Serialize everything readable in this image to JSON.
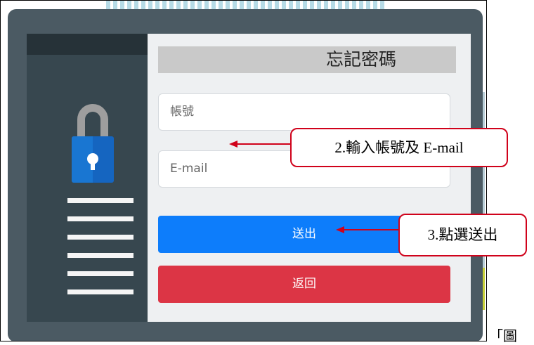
{
  "form": {
    "title": "忘記密碼",
    "account_placeholder": "帳號",
    "email_placeholder": "E-mail",
    "submit_label": "送出",
    "back_label": "返回"
  },
  "callouts": {
    "step2": "2.輸入帳號及 E-mail",
    "step3": "3.點選送出"
  },
  "caption_fragment": "「圖",
  "colors": {
    "modal_bg": "#4b5a63",
    "submit": "#0d7dfb",
    "back": "#dc3545",
    "callout_border": "#d0021b"
  },
  "icons": [
    "lock-icon",
    "menu-lines-icon"
  ]
}
